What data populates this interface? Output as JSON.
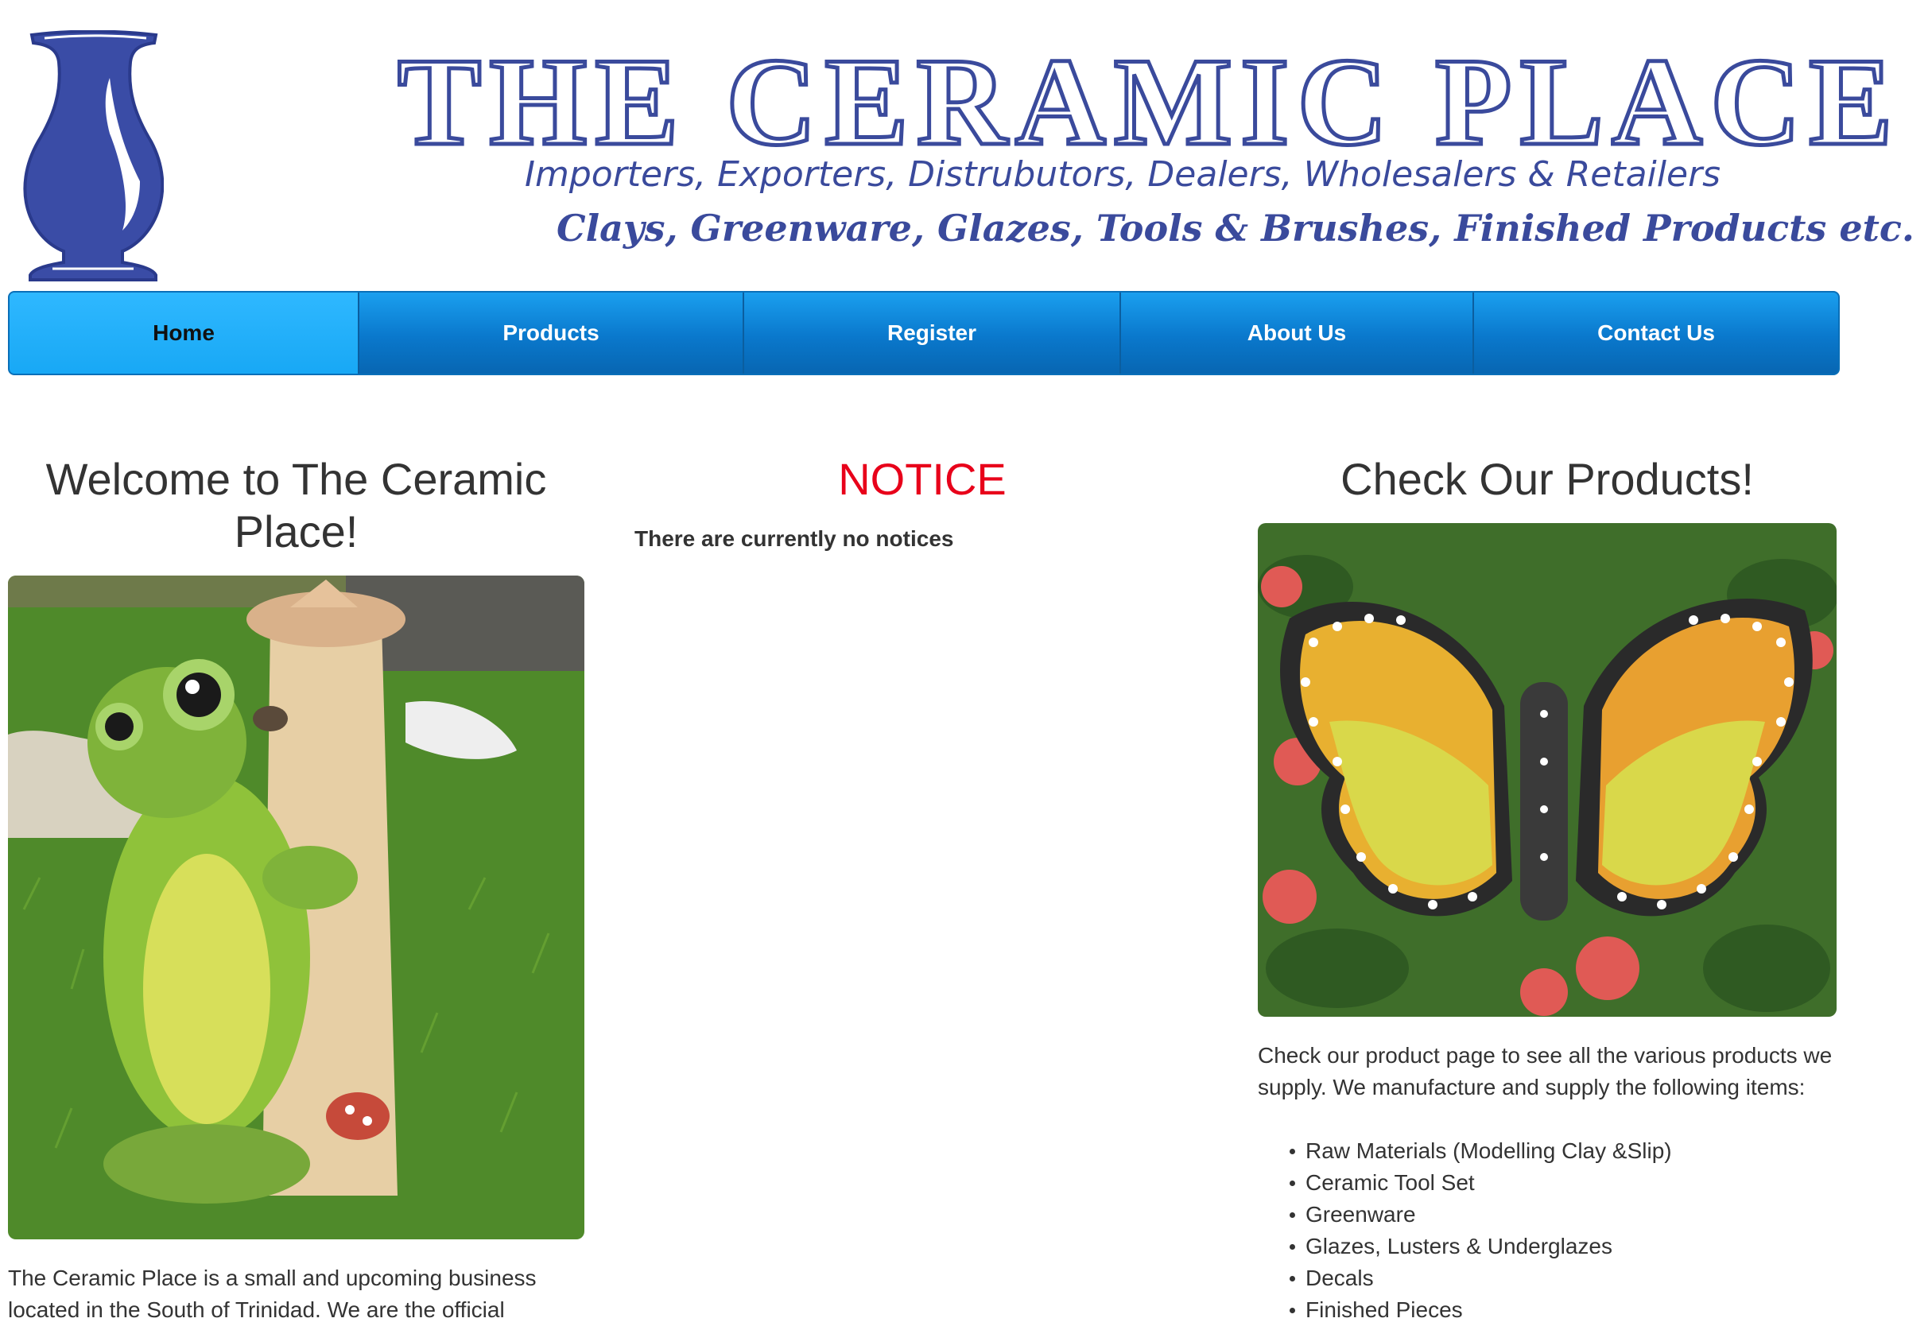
{
  "header": {
    "title": "THE CERAMIC PLACE",
    "tagline": "Importers, Exporters, Distrubutors, Dealers, Wholesalers & Retailers",
    "subtagline": "Clays, Greenware, Glazes, Tools & Brushes, Finished Products etc.",
    "logo_icon": "vase-icon",
    "brand_color": "#3a4a9c"
  },
  "nav": {
    "items": [
      {
        "label": "Home",
        "active": true
      },
      {
        "label": "Products",
        "active": false
      },
      {
        "label": "Register",
        "active": false
      },
      {
        "label": "About Us",
        "active": false
      },
      {
        "label": "Contact Us",
        "active": false
      }
    ],
    "color": "#0a78cc",
    "active_color": "#18a8f5"
  },
  "welcome": {
    "title": "Welcome to The Ceramic Place!",
    "text": "The Ceramic Place is a small and upcoming business located in the South of Trinidad. We are the official"
  },
  "notice": {
    "title": "NOTICE",
    "text": "There are currently no notices",
    "title_color": "#e8001a"
  },
  "products": {
    "title": "Check Our Products!",
    "intro": "Check our product page to see all the various products we supply. We manufacture and supply the following items:",
    "items": [
      "Raw Materials (Modelling Clay &Slip)",
      "Ceramic Tool Set",
      "Greenware",
      "Glazes, Lusters & Underglazes",
      "Decals",
      "Finished Pieces"
    ]
  }
}
